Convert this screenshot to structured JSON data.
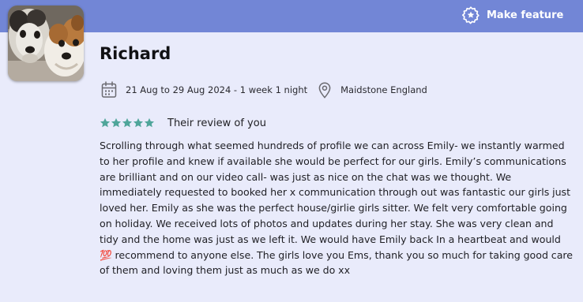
{
  "header": {
    "feature_button_label": "Make feature",
    "feature_icon": "gear-star-icon"
  },
  "reviewer": {
    "name": "Richard",
    "avatar": "dog-photo"
  },
  "stay": {
    "dates": "21 Aug to 29 Aug 2024 - 1 week 1 night",
    "location": "Maidstone England"
  },
  "review": {
    "rating": 5,
    "rating_max": 5,
    "rating_label": "Their review of you",
    "star_color": "#4fa59a",
    "text_before_emoji": "Scrolling through what seemed hundreds of profile we can across Emily- we instantly warmed to her profile and knew if available she would be perfect for our girls. Emily’s communications are brilliant and on our video call- was just as nice on the chat was we thought. We immediately requested to booked her x communication through out was fantastic our girls just loved her. Emily as she was the perfect house/girlie girls sitter. We felt very comfortable going on holiday. We received lots of photos and updates during her stay. She was very clean and tidy and the home was just as we left it. We would have Emily back In a heartbeat and would ",
    "emoji": "💯",
    "text_after_emoji": " recommend to anyone else. The girls love you Ems, thank you so much for taking good care of them and loving them just as much as we do xx"
  },
  "colors": {
    "header_bar": "#7286d6",
    "card_background": "#e9ebfb"
  }
}
